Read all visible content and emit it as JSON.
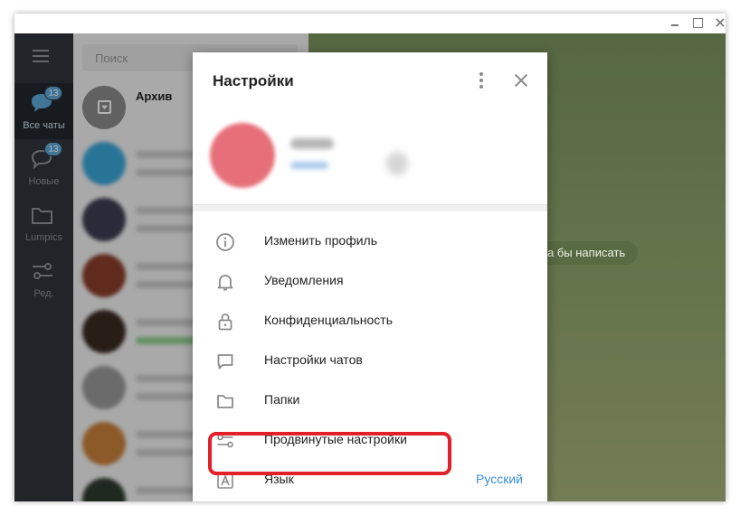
{
  "window": {
    "controls": [
      "minimize",
      "maximize",
      "close"
    ]
  },
  "rail": {
    "items": [
      {
        "label": "Все чаты",
        "badge": "13",
        "icon": "chats-icon",
        "active": true
      },
      {
        "label": "Новые",
        "badge": "13",
        "icon": "chat-bubble-icon",
        "active": false
      },
      {
        "label": "Lumpics",
        "badge": null,
        "icon": "folder-icon",
        "active": false
      },
      {
        "label": "Ред.",
        "badge": null,
        "icon": "sliders-icon",
        "active": false
      }
    ]
  },
  "chatlist": {
    "search_placeholder": "Поиск",
    "archive_label": "Архив"
  },
  "chat": {
    "hint_text": "а бы написать"
  },
  "dialog": {
    "title": "Настройки",
    "menu": [
      {
        "label": "Изменить профиль",
        "icon": "info-icon",
        "value": ""
      },
      {
        "label": "Уведомления",
        "icon": "bell-icon",
        "value": ""
      },
      {
        "label": "Конфиденциальность",
        "icon": "lock-icon",
        "value": ""
      },
      {
        "label": "Настройки чатов",
        "icon": "chat-icon",
        "value": ""
      },
      {
        "label": "Папки",
        "icon": "folder-icon",
        "value": ""
      },
      {
        "label": "Продвинутые настройки",
        "icon": "sliders-icon",
        "value": ""
      },
      {
        "label": "Язык",
        "icon": "language-icon",
        "value": "Русский"
      }
    ]
  },
  "colors": {
    "rail_bg": "#30343a",
    "accent_blue": "#3a8fd6",
    "badge_blue": "#5fa9dc",
    "highlight_red": "#e2202a"
  }
}
